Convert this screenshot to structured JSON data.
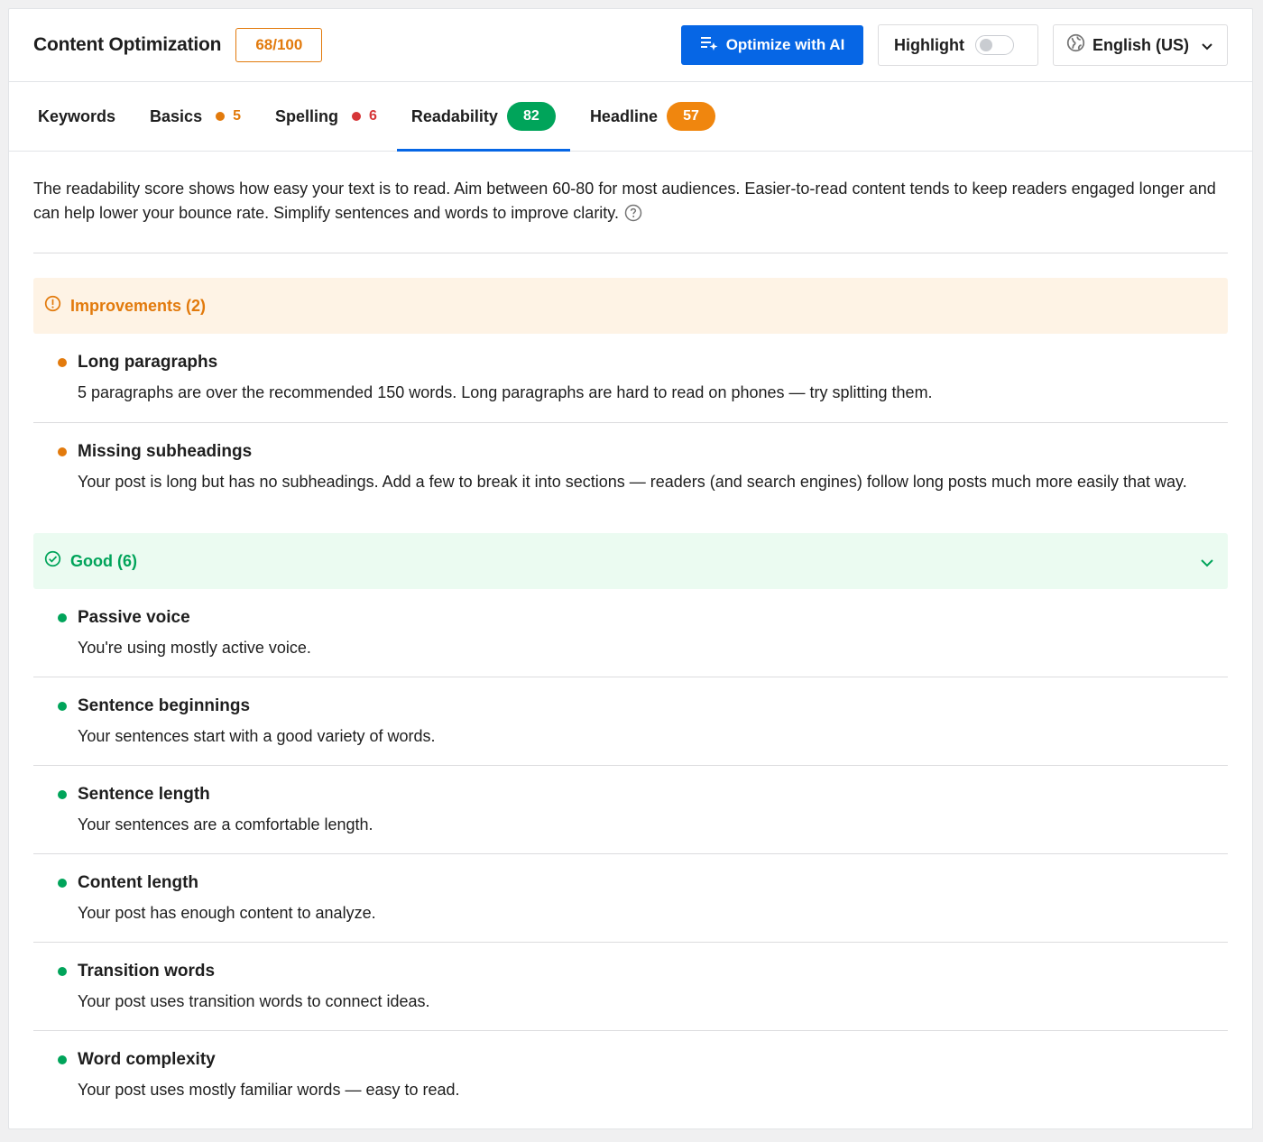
{
  "header": {
    "title": "Content Optimization",
    "score": "68/100",
    "optimize_label": "Optimize with AI",
    "highlight_label": "Highlight",
    "language_label": "English (US)"
  },
  "tabs": [
    {
      "label": "Keywords"
    },
    {
      "label": "Basics",
      "count": "5",
      "color": "#e27a0c"
    },
    {
      "label": "Spelling",
      "count": "6",
      "color": "#d63638"
    },
    {
      "label": "Readability",
      "score": "82",
      "color": "#00a45a",
      "active": true
    },
    {
      "label": "Headline",
      "score": "57",
      "color": "#f0860e"
    }
  ],
  "intro": "The readability score shows how easy your text is to read. Aim between 60-80 for most audiences. Easier-to-read content tends to keep readers engaged longer and can help lower your bounce rate. Simplify sentences and words to improve clarity.",
  "improvements": {
    "title": "Improvements (2)",
    "color": "#e27a0c",
    "items": [
      {
        "name": "Long paragraphs",
        "desc": "5 paragraphs are over the recommended 150 words. Long paragraphs are hard to read on phones — try splitting them."
      },
      {
        "name": "Missing subheadings",
        "desc": "Your post is long but has no subheadings. Add a few to break it into sections — readers (and search engines) follow long posts much more easily that way."
      }
    ]
  },
  "good": {
    "title": "Good (6)",
    "color": "#00a45a",
    "items": [
      {
        "name": "Passive voice",
        "desc": "You're using mostly active voice."
      },
      {
        "name": "Sentence beginnings",
        "desc": "Your sentences start with a good variety of words."
      },
      {
        "name": "Sentence length",
        "desc": "Your sentences are a comfortable length."
      },
      {
        "name": "Content length",
        "desc": "Your post has enough content to analyze."
      },
      {
        "name": "Transition words",
        "desc": "Your post uses transition words to connect ideas."
      },
      {
        "name": "Word complexity",
        "desc": "Your post uses mostly familiar words — easy to read."
      }
    ]
  }
}
